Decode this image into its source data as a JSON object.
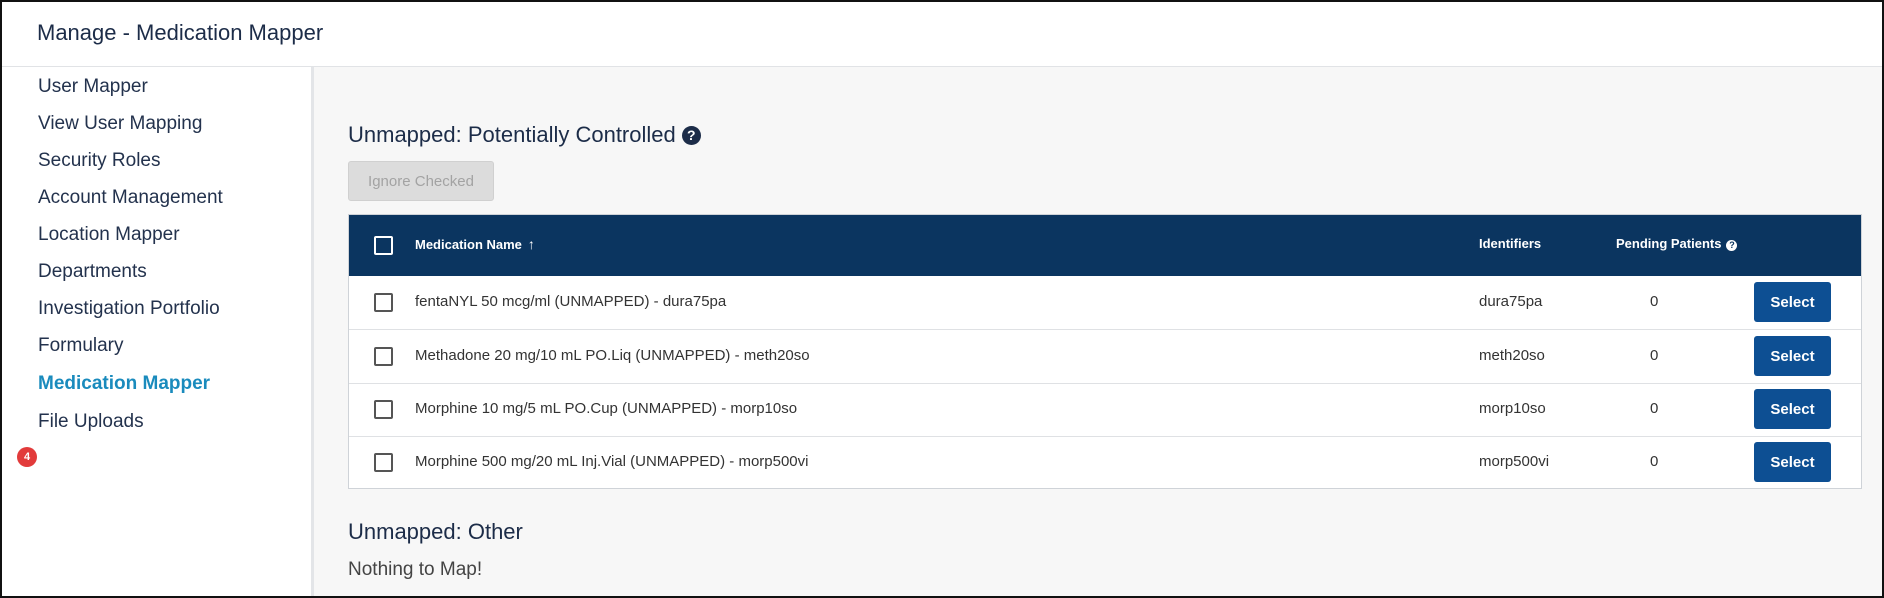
{
  "header": {
    "title": "Manage - Medication Mapper"
  },
  "sidebar": {
    "items": [
      {
        "label": "User Mapper"
      },
      {
        "label": "View User Mapping"
      },
      {
        "label": "Security Roles"
      },
      {
        "label": "Account Management"
      },
      {
        "label": "Location Mapper"
      },
      {
        "label": "Departments"
      },
      {
        "label": "Investigation Portfolio"
      },
      {
        "label": "Formulary"
      },
      {
        "label": "Medication Mapper",
        "badge": "4",
        "active": true
      },
      {
        "label": "File Uploads"
      }
    ]
  },
  "main": {
    "controlled": {
      "title": "Unmapped: Potentially Controlled",
      "help_icon": "question-circle-icon",
      "ignore_label": "Ignore Checked",
      "table": {
        "columns": {
          "name": "Medication Name",
          "identifiers": "Identifiers",
          "pending": "Pending Patients"
        },
        "rows": [
          {
            "name": "fentaNYL 50 mcg/ml (UNMAPPED) - dura75pa",
            "identifier": "dura75pa",
            "pending": "0",
            "action": "Select"
          },
          {
            "name": "Methadone 20 mg/10 mL PO.Liq (UNMAPPED) - meth20so",
            "identifier": "meth20so",
            "pending": "0",
            "action": "Select"
          },
          {
            "name": "Morphine 10 mg/5 mL PO.Cup (UNMAPPED) - morp10so",
            "identifier": "morp10so",
            "pending": "0",
            "action": "Select"
          },
          {
            "name": "Morphine 500 mg/20 mL Inj.Vial (UNMAPPED) - morp500vi",
            "identifier": "morp500vi",
            "pending": "0",
            "action": "Select"
          }
        ]
      }
    },
    "other": {
      "title": "Unmapped: Other",
      "empty_text": "Nothing to Map!"
    }
  },
  "colors": {
    "accent": "#1a8bbd",
    "table_header": "#0b3560",
    "button": "#0d4f93",
    "badge": "#e23b3b"
  }
}
